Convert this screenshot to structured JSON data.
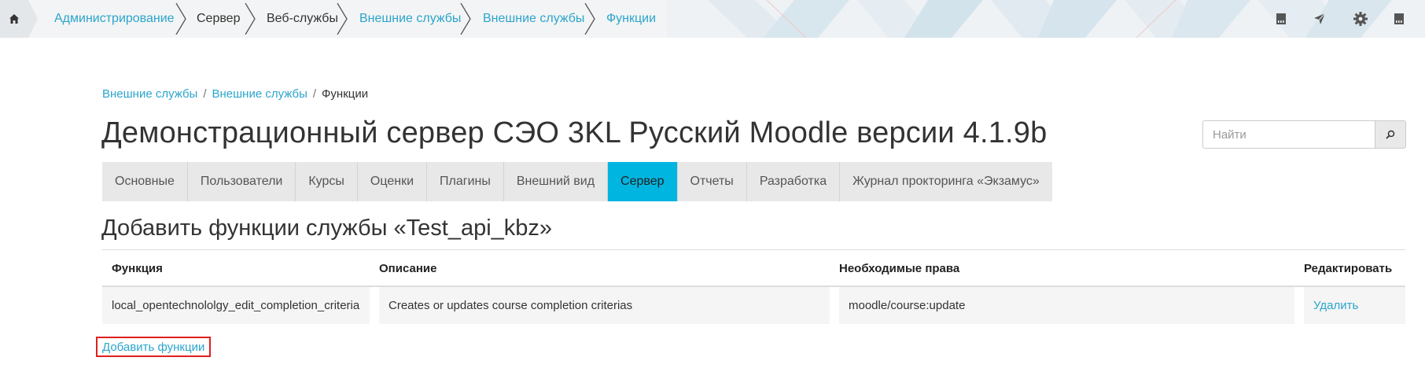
{
  "navbar": {
    "breadcrumbs": [
      {
        "label": "Администрирование",
        "link": true
      },
      {
        "label": "Сервер",
        "link": false
      },
      {
        "label": "Веб-службы",
        "link": false
      },
      {
        "label": "Внешние службы",
        "link": true
      },
      {
        "label": "Внешние службы",
        "link": true
      },
      {
        "label": "Функции",
        "link": true
      }
    ],
    "icons": [
      "home-icon",
      "sd-card-icon",
      "paper-plane-icon",
      "gear-icon",
      "sd-card-icon"
    ],
    "accent_color": "#2ba5cc"
  },
  "page_crumbs": {
    "items": [
      "Внешние службы",
      "Внешние службы",
      "Функции"
    ],
    "separator": "/"
  },
  "header": {
    "title": "Демонстрационный сервер СЭО 3KL Русский Moodle версии 4.1.9b"
  },
  "search": {
    "placeholder": "Найти"
  },
  "tabs": {
    "items": [
      "Основные",
      "Пользователи",
      "Курсы",
      "Оценки",
      "Плагины",
      "Внешний вид",
      "Сервер",
      "Отчеты",
      "Разработка",
      "Журнал прокторинга «Экзамус»"
    ],
    "active": "Сервер",
    "active_color": "#00b5e0"
  },
  "section": {
    "title": "Добавить функции службы «Test_api_kbz»"
  },
  "table": {
    "headers": [
      "Функция",
      "Описание",
      "Необходимые права",
      "Редактировать"
    ],
    "rows": [
      {
        "function": "local_opentechnololgy_edit_completion_criteria",
        "description": "Creates or updates course completion criterias",
        "capabilities": "moodle/course:update",
        "action": "Удалить"
      }
    ]
  },
  "actions": {
    "add_functions": "Добавить функции",
    "highlight_color": "#e02020"
  }
}
